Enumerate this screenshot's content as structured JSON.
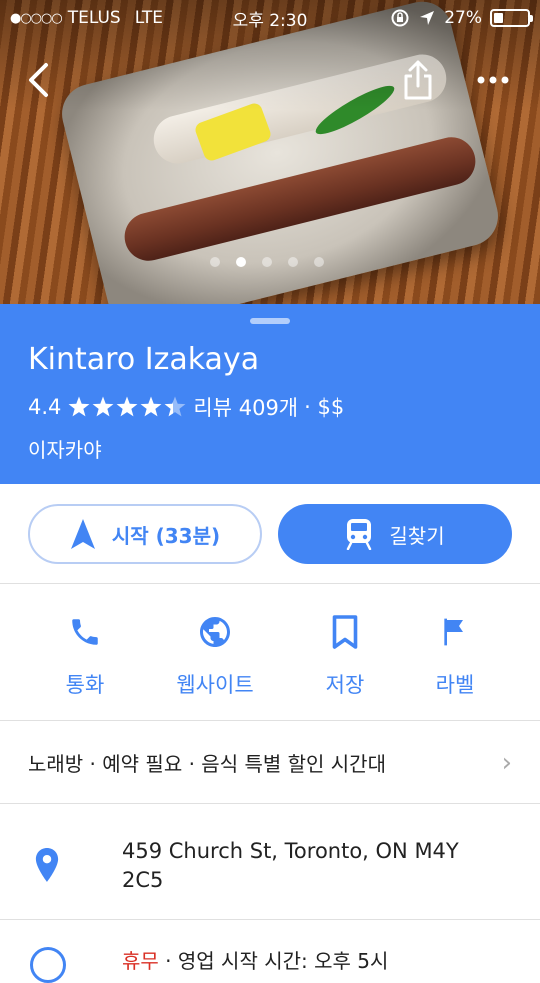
{
  "status_bar": {
    "signal": "●○○○○",
    "carrier": "TELUS",
    "network": "LTE",
    "time": "오후 2:30",
    "battery": "27%",
    "battery_level": 0.27
  },
  "hero": {
    "photo_count": 5,
    "active_photo_index": 1
  },
  "place": {
    "name": "Kintaro Izakaya",
    "rating": "4.4",
    "stars": 4.4,
    "reviews": "리뷰 409개",
    "price": "· $$",
    "category": "이자카야"
  },
  "actions": {
    "start_label": "시작 (33분)",
    "directions_label": "길찾기"
  },
  "quick_actions": [
    {
      "label": "통화",
      "icon": "phone-icon"
    },
    {
      "label": "웹사이트",
      "icon": "globe-icon"
    },
    {
      "label": "저장",
      "icon": "bookmark-icon"
    },
    {
      "label": "라벨",
      "icon": "flag-icon"
    }
  ],
  "features": "노래방 · 예약 필요 · 음식 특별 할인 시간대",
  "address": "459 Church St, Toronto, ON M4Y 2C5",
  "hours_partial": {
    "status": "휴무",
    "rest": "· 영업 시작 시간: 오후 5시"
  },
  "colors": {
    "accent": "#4285f4",
    "closed": "#d93025"
  }
}
